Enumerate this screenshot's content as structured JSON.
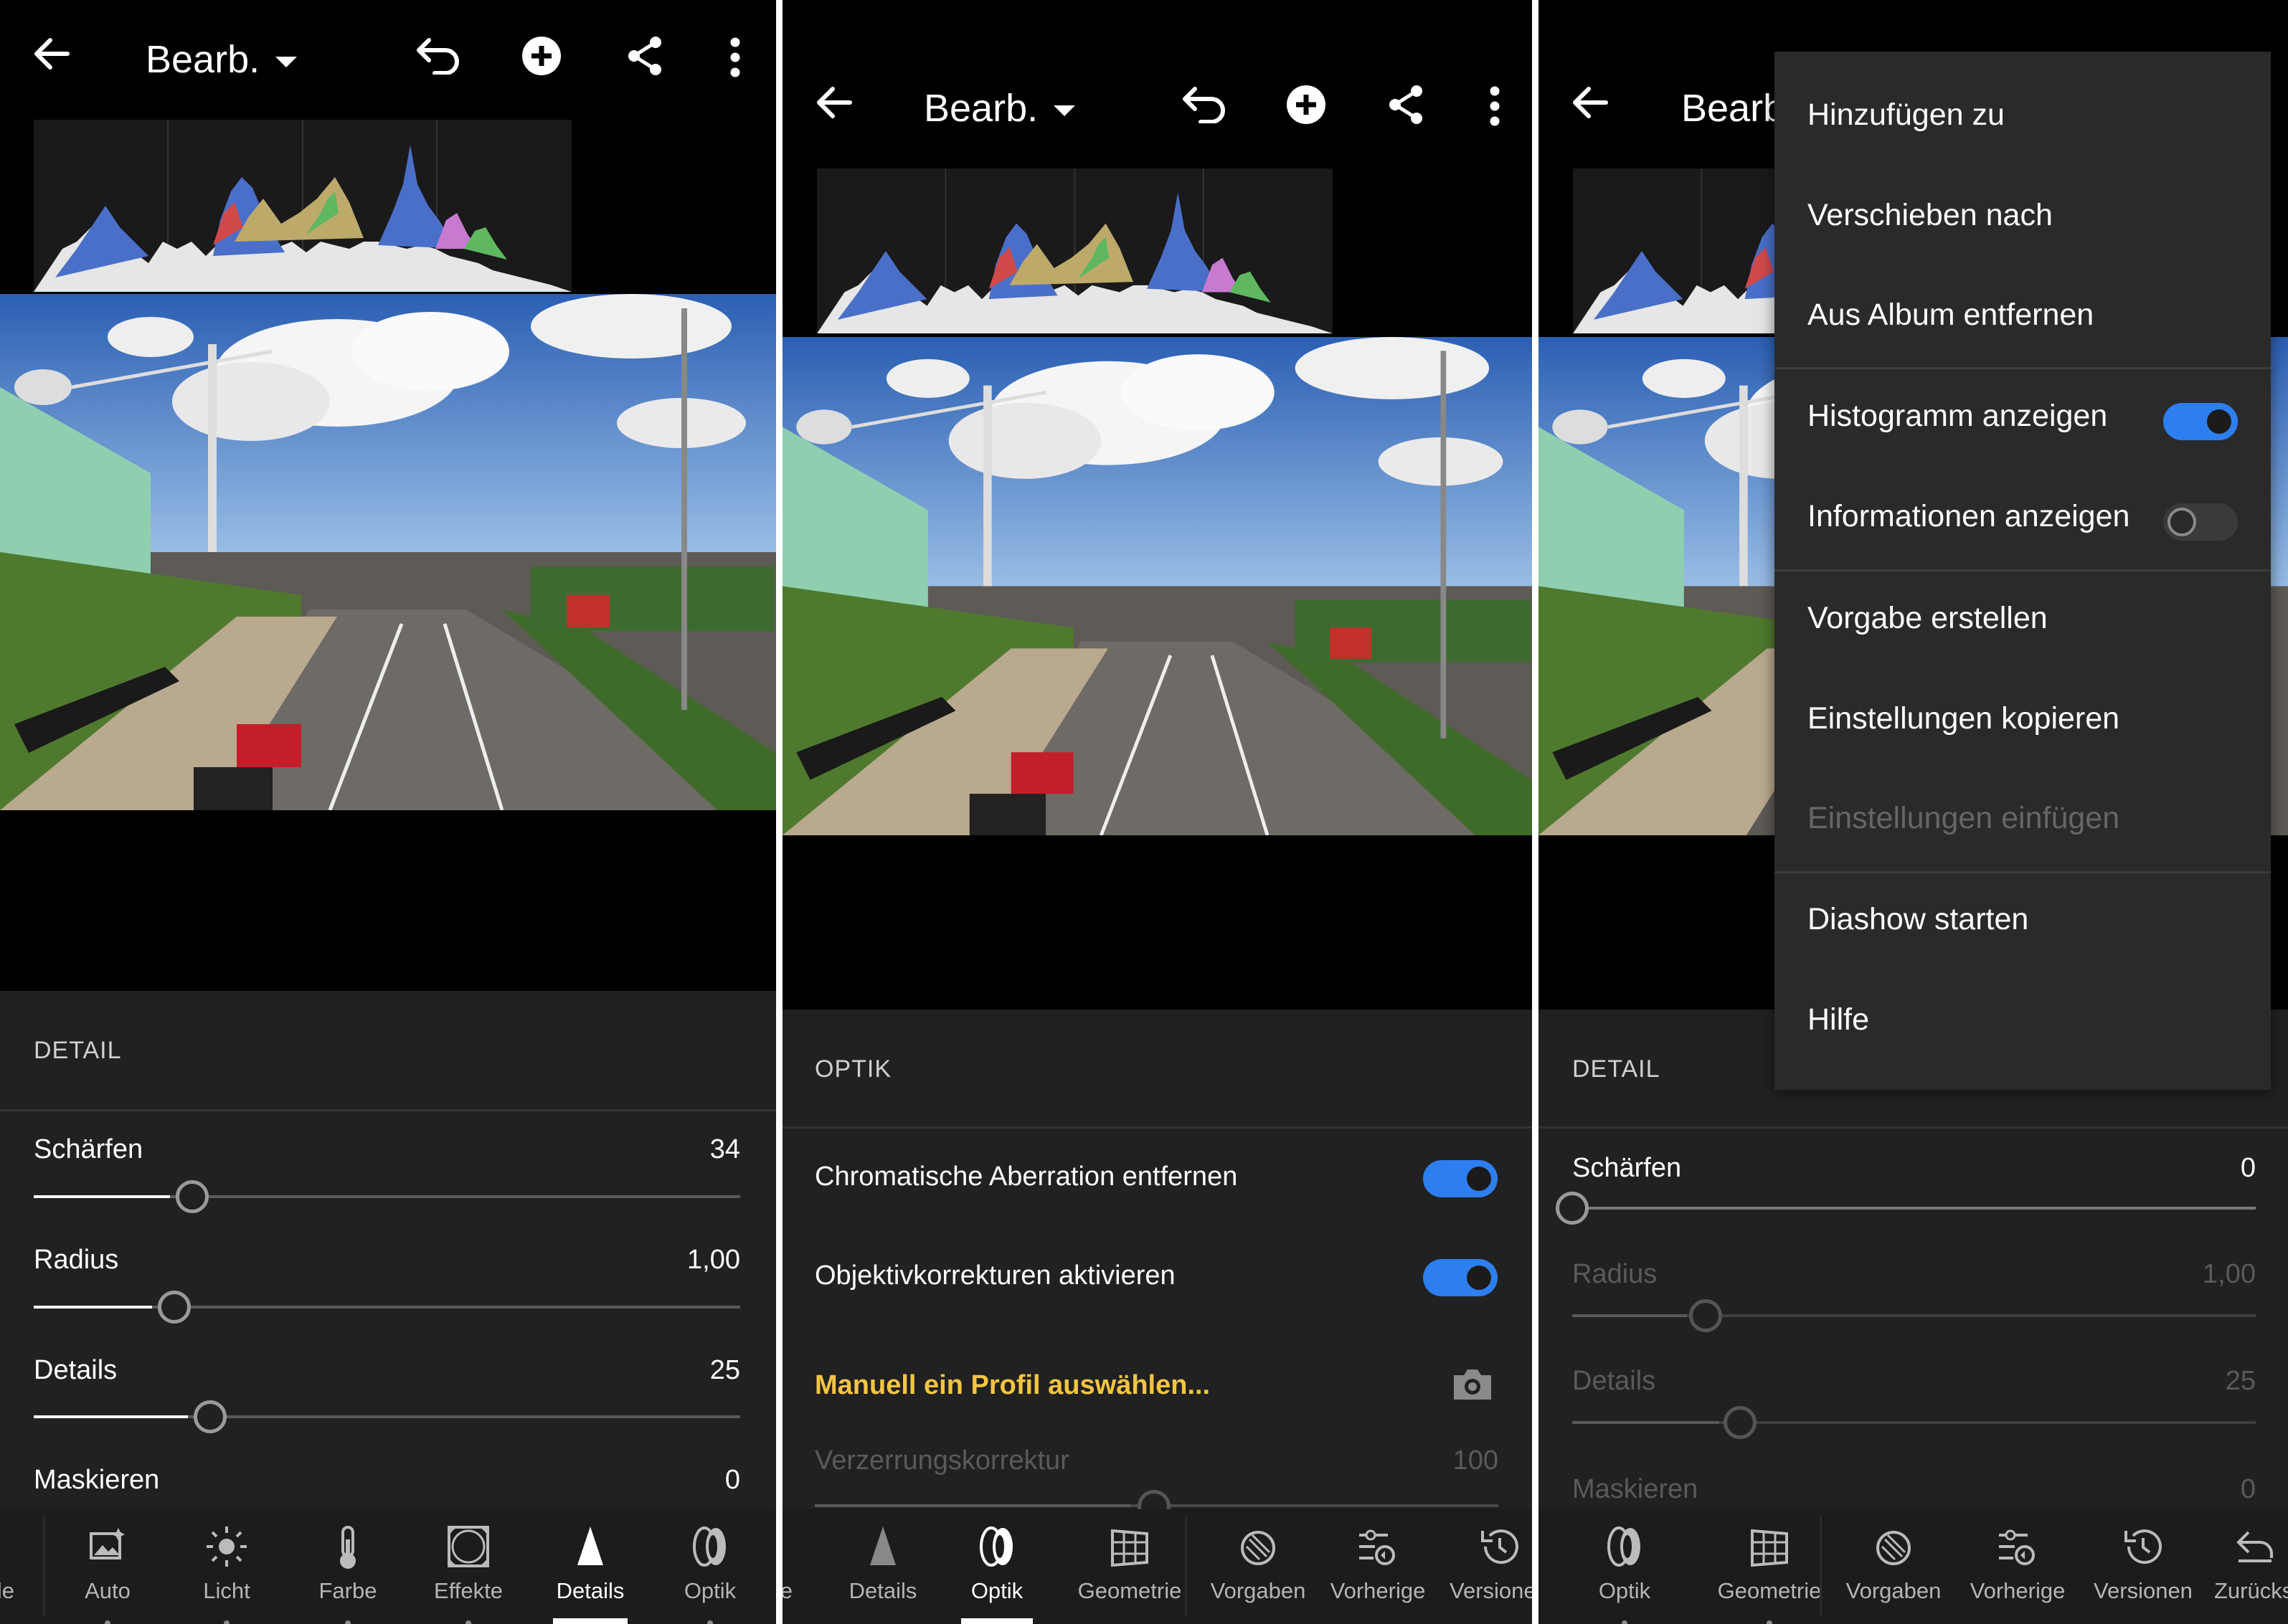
{
  "topbar": {
    "title": "Bearb.",
    "title_partial": "Bearb"
  },
  "panel1": {
    "section": "DETAIL",
    "sliders": [
      {
        "label": "Schärfen",
        "value": "34",
        "level": 0.23
      },
      {
        "label": "Radius",
        "value": "1,00",
        "level": 0.2
      },
      {
        "label": "Details",
        "value": "25",
        "level": 0.25
      },
      {
        "label": "Maskieren",
        "value": "0",
        "level": 0
      }
    ],
    "nav": [
      "le",
      "Auto",
      "Licht",
      "Farbe",
      "Effekte",
      "Details",
      "Optik"
    ],
    "active_nav": "Details"
  },
  "panel2": {
    "section": "OPTIK",
    "toggles": [
      {
        "label": "Chromatische Aberration entfernen",
        "on": true
      },
      {
        "label": "Objektivkorrekturen aktivieren",
        "on": true
      }
    ],
    "profile_link": "Manuell ein Profil auswählen...",
    "distortion": {
      "label": "Verzerrungskorrektur",
      "value": "100",
      "level": 0.5
    },
    "nav": [
      "e",
      "Details",
      "Optik",
      "Geometrie",
      "Vorgaben",
      "Vorherige",
      "Versionen"
    ],
    "active_nav": "Optik"
  },
  "panel3": {
    "section": "DETAIL",
    "sliders": [
      {
        "label": "Schärfen",
        "value": "0",
        "level": 0,
        "dim": false
      },
      {
        "label": "Radius",
        "value": "1,00",
        "level": 0.2,
        "dim": true
      },
      {
        "label": "Details",
        "value": "25",
        "level": 0.25,
        "dim": true
      },
      {
        "label": "Maskieren",
        "value": "0",
        "level": 0,
        "dim": true
      }
    ],
    "nav": [
      "Optik",
      "Geometrie",
      "Vorgaben",
      "Vorherige",
      "Versionen",
      "Zurücks"
    ]
  },
  "menu": {
    "items": [
      {
        "label": "Hinzufügen zu"
      },
      {
        "label": "Verschieben nach"
      },
      {
        "label": "Aus Album entfernen"
      },
      {
        "label": "Histogramm anzeigen",
        "toggle": true,
        "on": true
      },
      {
        "label": "Informationen anzeigen",
        "toggle": true,
        "on": false
      },
      {
        "label": "Vorgabe erstellen"
      },
      {
        "label": "Einstellungen kopieren"
      },
      {
        "label": "Einstellungen einfügen",
        "disabled": true
      },
      {
        "label": "Diashow starten"
      },
      {
        "label": "Hilfe"
      }
    ]
  },
  "colors": {
    "accent_toggle": "#2d7ff0",
    "link_yellow": "#f4c542",
    "panel_bg": "#212121",
    "nav_bg": "#1c1c1c"
  },
  "icons": [
    "back-arrow-icon",
    "dropdown-caret-icon",
    "undo-icon",
    "add-circle-icon",
    "share-icon",
    "more-vertical-icon",
    "camera-icon"
  ]
}
